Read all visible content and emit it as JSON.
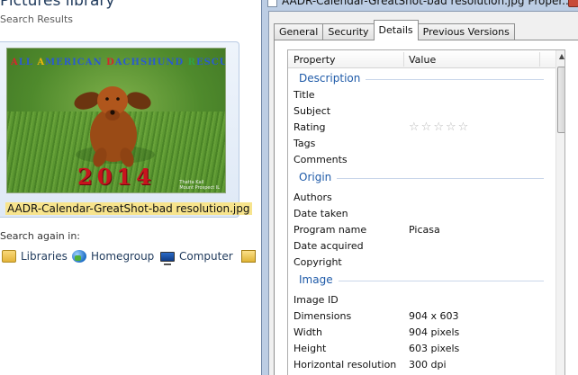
{
  "explorer": {
    "library_title": "Pictures library",
    "subtitle": "Search Results",
    "thumbnail": {
      "letters": [
        {
          "ch": "A",
          "color": "#d5262e"
        },
        {
          "ch": "LL ",
          "color": "#2a5bd0"
        },
        {
          "ch": "A",
          "color": "#e9b60c"
        },
        {
          "ch": "MERICAN  ",
          "color": "#2a5bd0"
        },
        {
          "ch": "D",
          "color": "#d5262e"
        },
        {
          "ch": "ACHSHUND  ",
          "color": "#2a5bd0"
        },
        {
          "ch": "R",
          "color": "#2fa246"
        },
        {
          "ch": "ESCUE",
          "color": "#2a5bd0"
        }
      ],
      "year": "2014",
      "credit_line_1": "Thatta Kail",
      "credit_line_2": "Mount Prospect IL"
    },
    "file_name": "AADR-Calendar-GreatShot-bad resolution.jpg",
    "search_again_label": "Search again in:",
    "locations": [
      "Libraries",
      "Homegroup",
      "Computer"
    ]
  },
  "properties": {
    "window_title": "AADR-Calendar-GreatShot-bad resolution.jpg Proper...",
    "tabs": [
      "General",
      "Security",
      "Details",
      "Previous Versions"
    ],
    "active_tab": "Details",
    "columns": {
      "property": "Property",
      "value": "Value"
    },
    "groups": {
      "description": {
        "name": "Description",
        "rows": [
          {
            "key": "Title",
            "value": ""
          },
          {
            "key": "Subject",
            "value": ""
          },
          {
            "key": "Rating",
            "value": ""
          },
          {
            "key": "Tags",
            "value": ""
          },
          {
            "key": "Comments",
            "value": ""
          }
        ],
        "rating_stars": 0
      },
      "origin": {
        "name": "Origin",
        "rows": [
          {
            "key": "Authors",
            "value": ""
          },
          {
            "key": "Date taken",
            "value": ""
          },
          {
            "key": "Program name",
            "value": "Picasa"
          },
          {
            "key": "Date acquired",
            "value": ""
          },
          {
            "key": "Copyright",
            "value": ""
          }
        ]
      },
      "image": {
        "name": "Image",
        "rows": [
          {
            "key": "Image ID",
            "value": ""
          },
          {
            "key": "Dimensions",
            "value": "904 x 603"
          },
          {
            "key": "Width",
            "value": "904 pixels"
          },
          {
            "key": "Height",
            "value": "603 pixels"
          },
          {
            "key": "Horizontal resolution",
            "value": "300 dpi"
          }
        ]
      }
    }
  }
}
